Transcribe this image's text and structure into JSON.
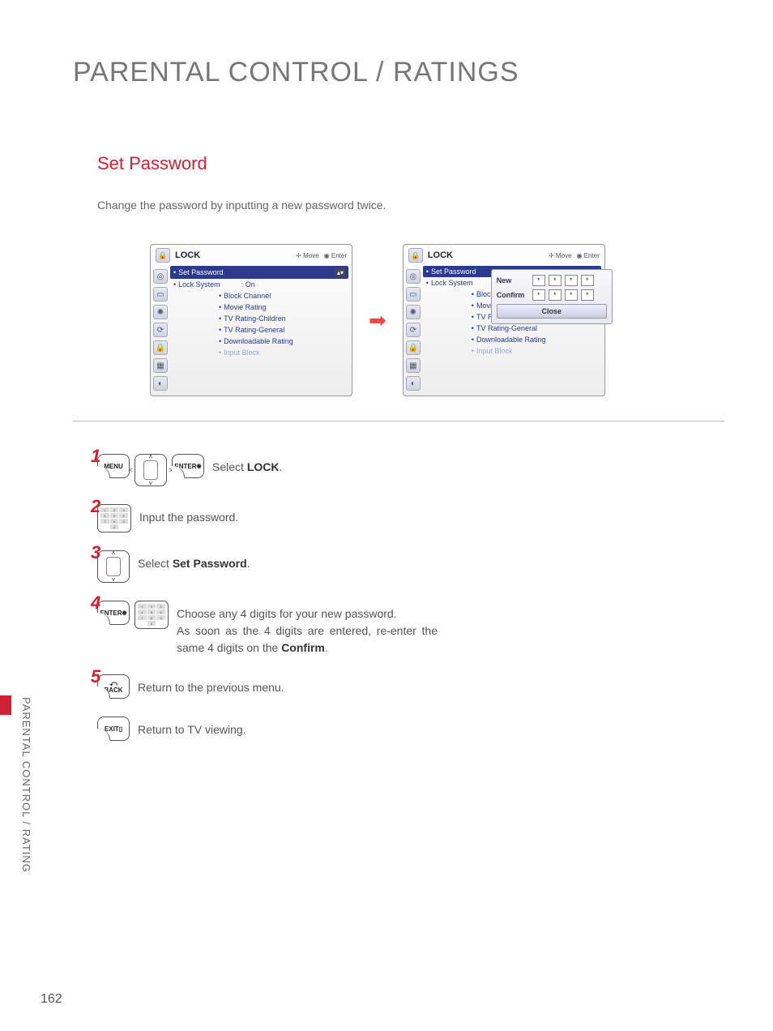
{
  "page_title": "PARENTAL CONTROL / RATINGS",
  "section_title": "Set Password",
  "intro": "Change the password by inputting a new password twice.",
  "osd": {
    "title": "LOCK",
    "hint_move": "Move",
    "hint_enter": "Enter",
    "items": [
      {
        "label": "Set Password",
        "value": ""
      },
      {
        "label": "Lock System",
        "value": ": On"
      },
      {
        "label": "Block Channel",
        "value": ""
      },
      {
        "label": "Movie Rating",
        "value": ""
      },
      {
        "label": "TV Rating-Children",
        "value": ""
      },
      {
        "label": "TV Rating-General",
        "value": ""
      },
      {
        "label": "Downloadable Rating",
        "value": ""
      },
      {
        "label": "Input Block",
        "value": ""
      }
    ],
    "popup": {
      "new_label": "New",
      "confirm_label": "Confirm",
      "mask": "*",
      "close": "Close"
    }
  },
  "steps": {
    "s1": {
      "num": "1",
      "btn_menu": "MENU",
      "btn_enter": "ENTER",
      "text_pre": "Select ",
      "text_bold": "LOCK",
      "text_post": "."
    },
    "s2": {
      "num": "2",
      "text": "Input the password."
    },
    "s3": {
      "num": "3",
      "text_pre": "Select ",
      "text_bold": "Set Password",
      "text_post": "."
    },
    "s4": {
      "num": "4",
      "btn_enter": "ENTER",
      "text_a": "Choose any 4 digits for your new password.",
      "text_b_pre": "As soon as the 4 digits are entered, re-enter the same 4 digits on the ",
      "text_b_bold": "Confirm",
      "text_b_post": "."
    },
    "s5": {
      "num": "5",
      "btn_back": "BACK",
      "text": "Return to the previous menu."
    },
    "s6": {
      "btn_exit": "EXIT",
      "text": "Return to TV viewing."
    }
  },
  "side_tab": "PARENTAL CONTROL / RATING",
  "page_number": "162"
}
